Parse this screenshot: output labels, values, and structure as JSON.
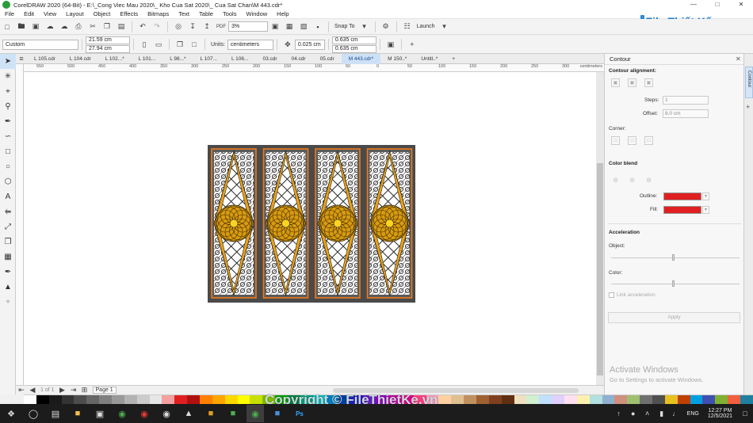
{
  "window": {
    "title": "CorelDRAW 2020 (64-Bit) - E:\\_Cong Viec Mau 2020\\_ Kho Cua Sat 2020\\_ Cua Sat Chan\\M 443.cdr*"
  },
  "menu": [
    "File",
    "Edit",
    "View",
    "Layout",
    "Object",
    "Effects",
    "Bitmaps",
    "Text",
    "Table",
    "Tools",
    "Window",
    "Help"
  ],
  "toolbar": {
    "zoom": "3%",
    "snap_to": "Snap To",
    "launch": "Launch"
  },
  "propbar": {
    "page_size": "Custom",
    "width": "21.59 cm",
    "height": "27.94 cm",
    "units_label": "Units:",
    "units": "centimeters",
    "nudge": "0.025 cm",
    "dup_x": "0.635 cm",
    "dup_y": "0.635 cm"
  },
  "tabs": [
    "L 105.cdr",
    "L 104.cdr",
    "L 102...*",
    "L 101...",
    "L 98...*",
    "L 107...",
    "L 106...",
    "03.cdr",
    "04.cdr",
    "05.cdr",
    "M 443.cdr*",
    "M 150..*",
    "Untitl..*"
  ],
  "active_tab": 10,
  "ruler": {
    "marks": [
      "550",
      "500",
      "450",
      "400",
      "350",
      "300",
      "250",
      "200",
      "150",
      "100",
      "50",
      "0",
      "50",
      "100",
      "150",
      "200",
      "250",
      "300"
    ],
    "unit": "centimeters"
  },
  "pagebar": {
    "page_count": "1 of 1",
    "page_label": "Page 1"
  },
  "docker": {
    "title": "Contour",
    "tab_label": "Contour",
    "contour_alignment": "Contour alignment:",
    "steps_label": "Steps:",
    "steps": "1",
    "offset_label": "Offset:",
    "offset": "8.0 cm",
    "corner": "Corner:",
    "color_blend": "Color blend",
    "outline_label": "Outline:",
    "fill_label": "Fill:",
    "outline_color": "#e02020",
    "fill_color": "#e02020",
    "acceleration": "Acceleration",
    "object_label": "Object:",
    "color_label": "Color:",
    "link_acceleration": "Link acceleration",
    "apply": "Apply"
  },
  "activation": {
    "title": "Activate Windows",
    "subtitle": "Go to Settings to activate Windows."
  },
  "watermark": {
    "brand_top": "File Thiết Kế.vn",
    "copyright": "Copyright © FileThietKe.vn"
  },
  "taskbar": {
    "lang": "ENG",
    "time": "12:27 PM",
    "date": "12/5/2021"
  },
  "palette_colors": [
    "#ffffff",
    "#000000",
    "#1a1a1a",
    "#333",
    "#4d4d4d",
    "#666",
    "#808080",
    "#999",
    "#b3b3b3",
    "#ccc",
    "#e6e6e6",
    "#f5a0a0",
    "#e02020",
    "#b01010",
    "#ff7f00",
    "#ffa500",
    "#ffd700",
    "#ffff00",
    "#c8e000",
    "#80c000",
    "#00a000",
    "#008040",
    "#00a080",
    "#00c0c0",
    "#0080c0",
    "#0040a0",
    "#2020c0",
    "#6020c0",
    "#9000c0",
    "#c000a0",
    "#e0008a",
    "#ff4080",
    "#ff9fbf",
    "#ffd0a0",
    "#e0c090",
    "#c09060",
    "#a06030",
    "#804020",
    "#603010",
    "#f0e0c0",
    "#d0f0d0",
    "#c0e0ff",
    "#e0d0ff",
    "#ffe0f0",
    "#fff0b0",
    "#b0e0e0",
    "#90b0d0",
    "#d09080",
    "#a0c070",
    "#707070",
    "#505050",
    "#e8c020",
    "#c04000",
    "#00a0e0",
    "#4050b0",
    "#80b030",
    "#f06040",
    "#2080a0"
  ]
}
